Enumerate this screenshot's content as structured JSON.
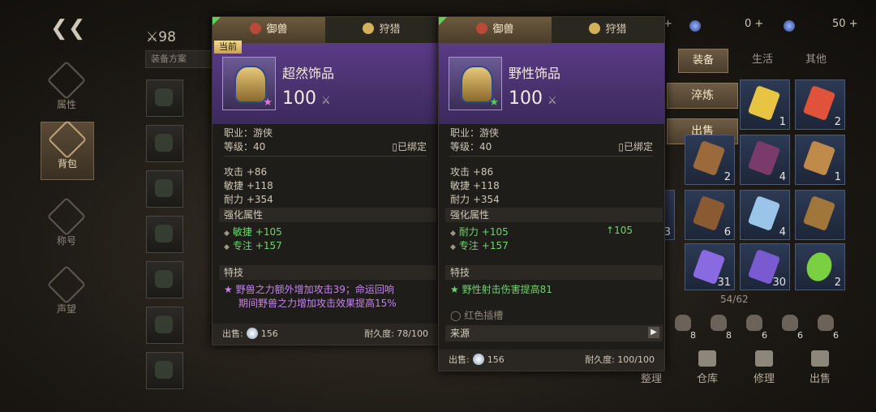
{
  "left": {
    "count": "98",
    "equip_plan": "装备方案",
    "nav": [
      {
        "label": "属性",
        "icon": "attribute-icon"
      },
      {
        "label": "背包",
        "icon": "backpack-icon"
      },
      {
        "label": "称号",
        "icon": "title-icon"
      },
      {
        "label": "声望",
        "icon": "reputation-icon"
      }
    ]
  },
  "top_bar": {
    "res1": "0",
    "res2": "50"
  },
  "inventory": {
    "tabs": [
      "装备",
      "生活",
      "其他"
    ],
    "actions": [
      "淬炼",
      "出售"
    ],
    "quantities": [
      "1",
      "2",
      "2",
      "4",
      "1",
      "3",
      "6",
      "4",
      "31",
      "30",
      "2"
    ],
    "capacity": "54/62",
    "mini_quantities": [
      "8",
      "8",
      "6",
      "6",
      "6"
    ],
    "bottom_actions": [
      "整理",
      "仓库",
      "修理",
      "出售"
    ]
  },
  "panels": [
    {
      "tabs": [
        "御兽",
        "狩猎"
      ],
      "badge": "当前",
      "name": "超然饰品",
      "power": "100",
      "class": "职业：游侠",
      "level": "等级：40",
      "bound": "已绑定",
      "stats": [
        "攻击 +86",
        "敏捷 +118",
        "耐力 +354"
      ],
      "enhance_title": "强化属性",
      "enhance": [
        {
          "name": "敏捷",
          "value": "+105"
        },
        {
          "name": "专注",
          "value": "+157"
        }
      ],
      "skill_title": "特技",
      "skill_line1": "野兽之力额外增加攻击39；命运回响",
      "skill_line2": "期间野兽之力增加攻击效果提高15%",
      "sell_label": "出售:",
      "sell_value": "156",
      "durability": "耐久度: 78/100"
    },
    {
      "tabs": [
        "御兽",
        "狩猎"
      ],
      "name": "野性饰品",
      "power": "100",
      "class": "职业：游侠",
      "level": "等级：40",
      "bound": "已绑定",
      "stats": [
        "攻击 +86",
        "敏捷 +118",
        "耐力 +354"
      ],
      "enhance_title": "强化属性",
      "enhance": [
        {
          "name": "耐力",
          "value": "+105",
          "diff": "105"
        },
        {
          "name": "专注",
          "value": "+157"
        }
      ],
      "skill_title": "特技",
      "skill_line1": "野性射击伤害提高81",
      "socket": "红色插槽",
      "source": "来源",
      "sell_label": "出售:",
      "sell_value": "156",
      "durability": "耐久度: 100/100"
    }
  ],
  "colors": {
    "accent": "#5a3b86",
    "gold": "#c8a24e",
    "green": "#6fd66b",
    "purple": "#c783f0"
  }
}
